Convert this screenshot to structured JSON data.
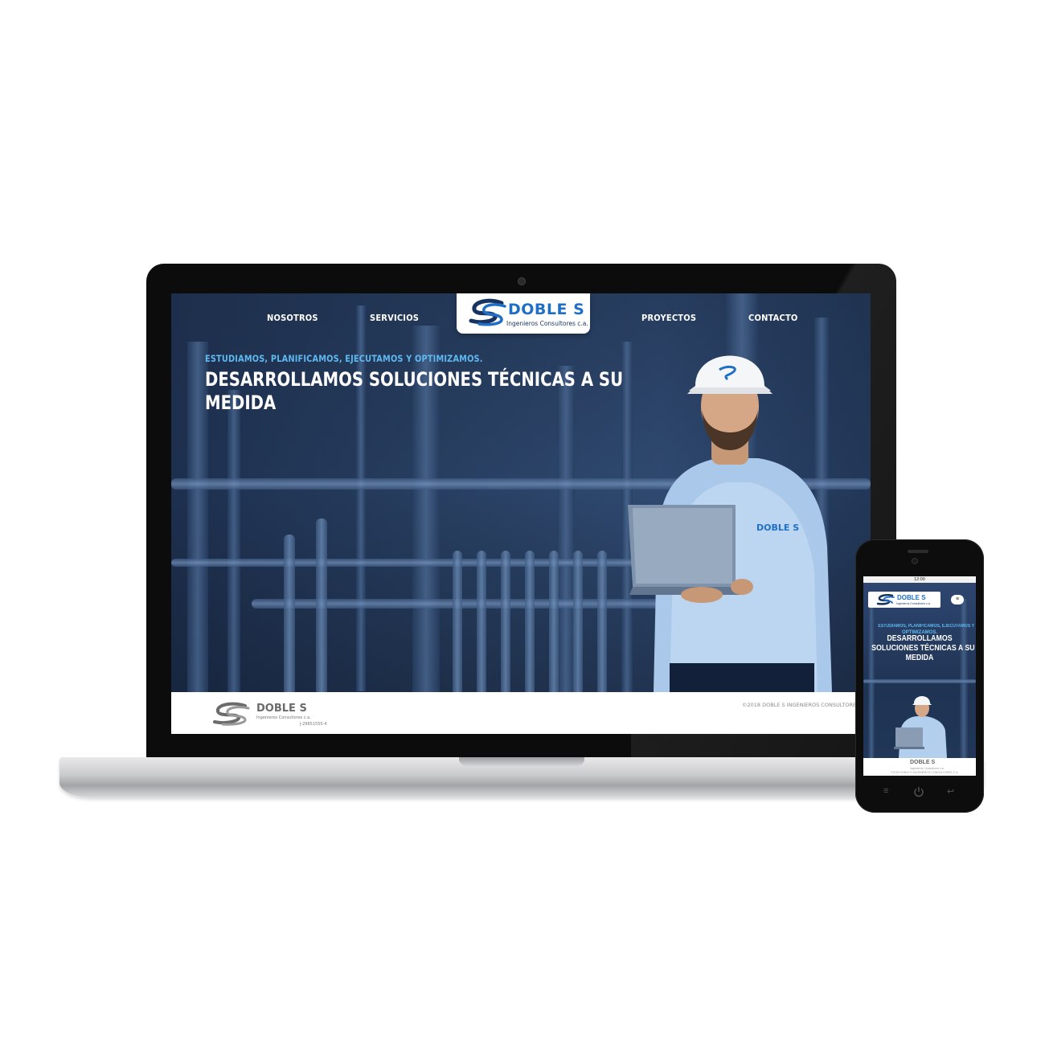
{
  "laptop": {
    "nav": {
      "items": [
        "NOSOTROS",
        "SERVICIOS",
        "PROYECTOS",
        "CONTACTO"
      ],
      "logo": {
        "word": "DOBLE S",
        "sub": "Ingenieros Consultores c.a."
      }
    },
    "hero": {
      "tagline": "ESTUDIAMOS, PLANIFICAMOS, EJECUTAMOS Y OPTIMIZAMOS.",
      "headline_line1": "DESARROLLAMOS SOLUCIONES TÉCNICAS A SU",
      "headline_line2": "MEDIDA"
    },
    "footer": {
      "logo_word": "DOBLE S",
      "logo_sub": "Ingenieros Consultores c.a.",
      "rif": "J-29651555-4",
      "copyright": "©2018 DOBLE S INGENIEROS CONSULTORES C.A"
    }
  },
  "phone": {
    "status_time": "12:00",
    "logo_word": "DOBLE S",
    "logo_sub": "Ingenieros Consultores c.a.",
    "tagline_line1": "ESTUDIAMOS, PLANIFICAMOS, EJECUTAMOS Y",
    "tagline_line2": "OPTIMIZAMOS.",
    "headline_line1": "DESARROLLAMOS",
    "headline_line2": "SOLUCIONES TÉCNICAS A SU",
    "headline_line3": "MEDIDA",
    "footer_word": "DOBLE S",
    "footer_sub": "Ingenieros Consultores c.a.",
    "footer_copy": "©2018 DOBLE S INGENIEROS CONSULTORES C.A"
  },
  "colors": {
    "accent_blue": "#1f6fc7",
    "tagline_blue": "#5fb8f0",
    "hero_dark": "#1e3050"
  },
  "icons": {
    "logo": "double-s-swoosh-logo",
    "menu": "hamburger-menu-icon",
    "phone_nav": [
      "menu-lines-icon",
      "power-icon",
      "back-icon"
    ]
  }
}
